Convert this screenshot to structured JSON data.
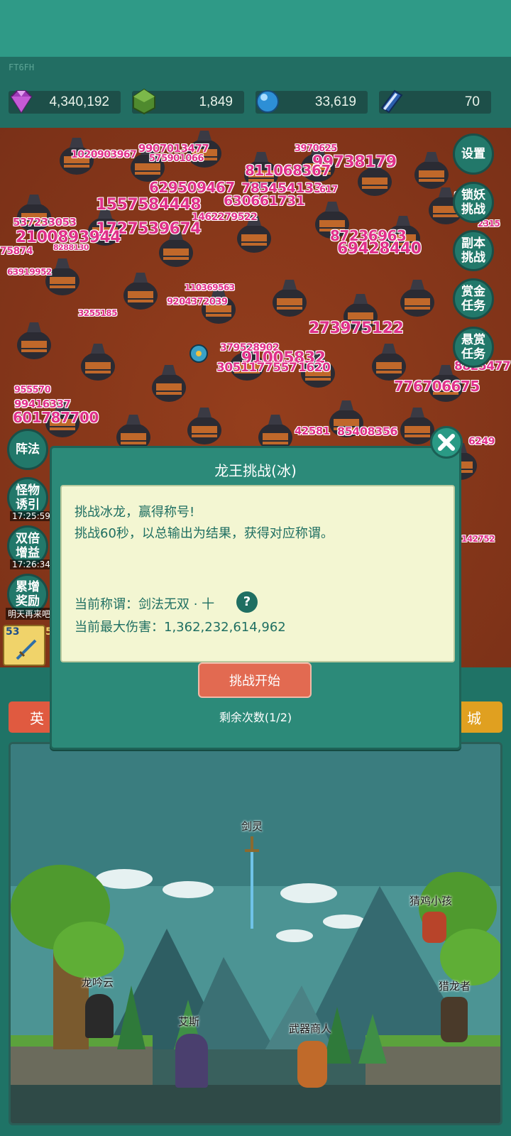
{
  "status": {
    "build_code": "FT6FH"
  },
  "resources": [
    {
      "name": "gem",
      "icon": "purple-gem-icon",
      "value": "4,340,192"
    },
    {
      "name": "jade",
      "icon": "green-crystal-icon",
      "value": "1,849"
    },
    {
      "name": "orb",
      "icon": "blue-orb-icon",
      "value": "33,619"
    },
    {
      "name": "book",
      "icon": "blue-book-icon",
      "value": "70"
    }
  ],
  "battle": {
    "damage_numbers": [
      "9907013477",
      "1020903967",
      "575901066",
      "3970625",
      "99738179",
      "811068367",
      "629509467",
      "785454133",
      "617",
      "1557584448",
      "630661731",
      "1462279522",
      "537233053",
      "1727539674",
      "2100893944",
      "87236963",
      "69428440",
      "75874",
      "8288130",
      "63919952",
      "9204372039",
      "110369563",
      "3255185",
      "273975122",
      "379528902",
      "91005832",
      "3051177557",
      "1620",
      "955570",
      "99416337",
      "601787700",
      "776706675",
      "42581",
      "85408356",
      "8825477",
      "6249",
      "142752",
      "749",
      "2315",
      "9315"
    ]
  },
  "side_buttons_right": [
    {
      "label": "设置"
    },
    {
      "label": "锁妖\n挑战"
    },
    {
      "label": "副本\n挑战"
    },
    {
      "label": "赏金\n任务"
    },
    {
      "label": "悬赏\n任务"
    }
  ],
  "side_buttons_left": [
    {
      "label": "阵法",
      "timer": ""
    },
    {
      "label": "怪物\n诱引",
      "timer": "17:25:59"
    },
    {
      "label": "双倍\n增益",
      "timer": "17:26:34"
    },
    {
      "label": "累增\n奖励",
      "timer": "明天再来吧"
    }
  ],
  "weapon_slot": {
    "level_left": "53",
    "level_right": "5"
  },
  "tabs": {
    "left": "英",
    "right": "城"
  },
  "scene": {
    "npcs": [
      {
        "label": "剑灵"
      },
      {
        "label": "猜鸡小孩"
      },
      {
        "label": "龙吟云"
      },
      {
        "label": "猎龙者"
      },
      {
        "label": "艾斯"
      },
      {
        "label": "武器商人"
      }
    ]
  },
  "modal": {
    "title": "龙王挑战(冰)",
    "desc_line1": "挑战冰龙，赢得称号!",
    "desc_line2": "挑战60秒，以总输出为结果，获得对应称谓。",
    "current_title_label": "当前称谓：剑法无双 · 十",
    "help_glyph": "?",
    "max_damage_label": "当前最大伤害：1,362,232,614,962",
    "start_button": "挑战开始",
    "remaining": "剩余次数(1/2)",
    "close_glyph": "✕"
  }
}
